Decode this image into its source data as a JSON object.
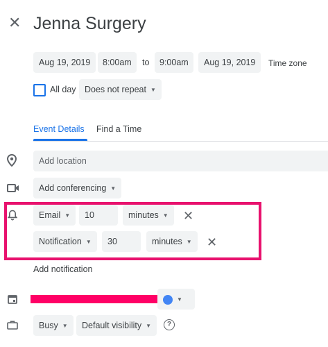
{
  "header": {
    "title": "Jenna Surgery"
  },
  "datetime": {
    "start_date": "Aug 19, 2019",
    "start_time": "8:00am",
    "separator": "to",
    "end_time": "9:00am",
    "end_date": "Aug 19, 2019",
    "time_zone": "Time zone"
  },
  "allday": {
    "label": "All day",
    "checked": false
  },
  "repeat": {
    "value": "Does not repeat"
  },
  "tabs": [
    {
      "label": "Event Details",
      "active": true
    },
    {
      "label": "Find a Time",
      "active": false
    }
  ],
  "location": {
    "placeholder": "Add location"
  },
  "conferencing": {
    "label": "Add conferencing"
  },
  "notifications": [
    {
      "type": "Email",
      "amount": "10",
      "unit": "minutes"
    },
    {
      "type": "Notification",
      "amount": "30",
      "unit": "minutes"
    }
  ],
  "add_notification": "Add notification",
  "calendar": {
    "color": "#4285f4",
    "redaction_color": "#ff0066"
  },
  "availability": {
    "busy": "Busy",
    "visibility": "Default visibility"
  },
  "highlight_color": "#e8126e",
  "accent_color": "#1a73e8"
}
